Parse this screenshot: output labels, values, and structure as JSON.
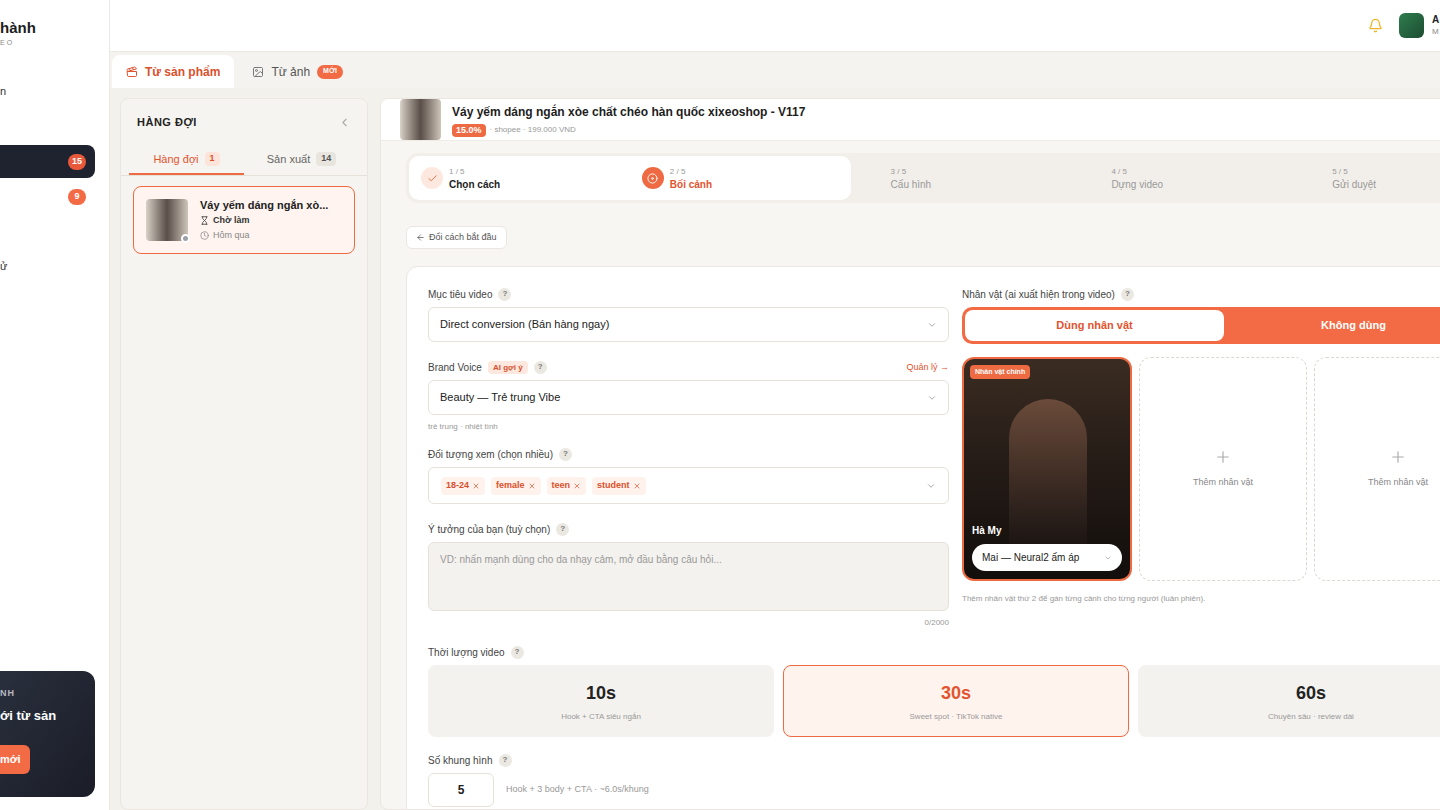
{
  "sidebar": {
    "brand": "hành",
    "brand_sub": "EO",
    "items": [
      {
        "label": "n",
        "badge": "",
        "selected": false
      },
      {
        "label": "",
        "badge": "",
        "selected": false
      },
      {
        "label": "",
        "badge": "15",
        "selected": true
      },
      {
        "label": "",
        "badge": "9",
        "selected": false
      },
      {
        "label": "",
        "badge": "",
        "selected": false
      },
      {
        "label": "ử",
        "badge": "",
        "selected": false
      }
    ],
    "promo": {
      "title": "NH",
      "text": "ới từ sản",
      "button": "mới"
    }
  },
  "header": {
    "user_name": "A",
    "user_sub": "M"
  },
  "source_tabs": [
    {
      "label": "Từ sản phẩm",
      "badge": "",
      "selected": true
    },
    {
      "label": "Từ ảnh",
      "badge": "MỚI",
      "selected": false
    }
  ],
  "queue": {
    "title": "HÀNG ĐỢI",
    "tabs": [
      {
        "label": "Hàng đợi",
        "count": "1",
        "selected": true
      },
      {
        "label": "Sản xuất",
        "count": "14",
        "selected": false
      }
    ],
    "items": [
      {
        "title": "Váy yếm dáng ngắn xò...",
        "status": "Chờ làm",
        "time": "Hôm qua",
        "selected": true
      }
    ]
  },
  "product": {
    "title": "Váy yếm dáng ngắn xòe chất chéo hàn quốc xixeoshop - V117",
    "commission": "15.0%",
    "meta": "· shopee · 199.000 VND"
  },
  "steps": [
    {
      "index": "1 / 5",
      "label": "Chọn cách",
      "done": true,
      "selected": false
    },
    {
      "index": "2 / 5",
      "label": "Bối cảnh",
      "done": false,
      "selected": true
    },
    {
      "index": "3 / 5",
      "label": "Cấu hình",
      "done": false,
      "selected": false
    },
    {
      "index": "4 / 5",
      "label": "Dựng video",
      "done": false,
      "selected": false
    },
    {
      "index": "5 / 5",
      "label": "Gửi duyệt",
      "done": false,
      "selected": false
    }
  ],
  "back_button": "Đổi cách bắt đầu",
  "help": "?",
  "form": {
    "goal": {
      "label": "Mục tiêu video",
      "value": "Direct conversion (Bán hàng ngay)"
    },
    "brand_voice": {
      "label": "Brand Voice",
      "badge": "AI gợi ý",
      "action": "Quản lý →",
      "value": "Beauty — Trẻ trung Vibe",
      "hint": "trẻ trung · nhiệt tình"
    },
    "audience": {
      "label": "Đối tượng xem (chọn nhiều)",
      "tags": [
        "18-24",
        "female",
        "teen",
        "student"
      ]
    },
    "idea": {
      "label": "Ý tưởng của bạn (tuỳ chọn)",
      "placeholder": "VD: nhấn mạnh dùng cho da nhạy cảm, mở đầu bằng câu hỏi...",
      "counter": "0/2000"
    },
    "characters": {
      "label": "Nhân vật (ai xuất hiện trong video)",
      "modes": [
        {
          "label": "Dùng nhân vật",
          "selected": true
        },
        {
          "label": "Không dùng",
          "selected": false
        }
      ],
      "cards": [
        {
          "kind": "character",
          "badge": "Nhân vật chính",
          "name": "Hà My",
          "voice": "Mai — Neural2 ấm áp"
        },
        {
          "kind": "add",
          "label": "Thêm nhân vật"
        },
        {
          "kind": "add",
          "label": "Thêm nhân vật"
        }
      ],
      "hint": "Thêm nhân vật thứ 2 để gán từng cảnh cho từng người (luân phiên)."
    },
    "duration": {
      "label": "Thời lượng video",
      "options": [
        {
          "value": "10s",
          "desc": "Hook + CTA siêu ngắn",
          "selected": false
        },
        {
          "value": "30s",
          "desc": "Sweet spot · TikTok native",
          "selected": true
        },
        {
          "value": "60s",
          "desc": "Chuyên sâu · review dài",
          "selected": false
        }
      ]
    },
    "frames": {
      "label": "Số khung hình",
      "value": "5",
      "hint": "Hook + 3 body + CTA · ~6.0s/khung"
    }
  }
}
